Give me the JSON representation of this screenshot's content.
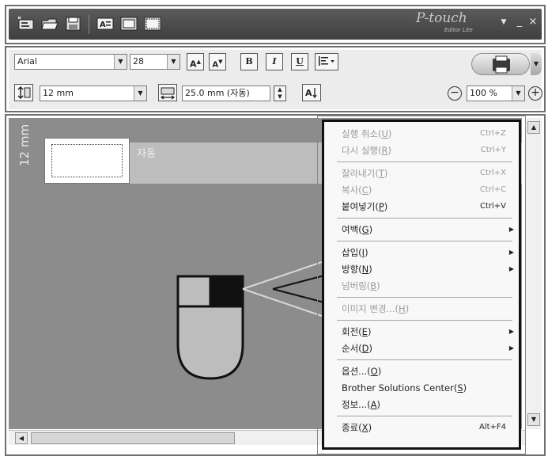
{
  "titlebar": {
    "logo": "P-touch",
    "logo_sub": "Editor Lite",
    "icons": [
      "new-label-icon",
      "open-folder-icon",
      "save-icon",
      "text-icon",
      "frame-icon",
      "image-icon"
    ],
    "minimize": "_",
    "close": "×"
  },
  "format_bar": {
    "font_name": "Arial",
    "font_size": "28",
    "grow_font": "A",
    "shrink_font": "A",
    "bold": "B",
    "italic": "I",
    "underline": "U",
    "tape_width": "12 mm",
    "label_length": "25.0 mm (자동)",
    "zoom": "100 %",
    "zoom_out": "−",
    "zoom_in": "+"
  },
  "canvas": {
    "auto_label": "자동",
    "tape_size": "12 mm"
  },
  "context_menu": {
    "groups": [
      [
        {
          "label": "실행 취소",
          "key": "U",
          "shortcut": "Ctrl+Z",
          "enabled": false,
          "submenu": false
        },
        {
          "label": "다시 실행",
          "key": "R",
          "shortcut": "Ctrl+Y",
          "enabled": false,
          "submenu": false
        }
      ],
      [
        {
          "label": "잘라내기",
          "key": "T",
          "shortcut": "Ctrl+X",
          "enabled": false,
          "submenu": false
        },
        {
          "label": "복사",
          "key": "C",
          "shortcut": "Ctrl+C",
          "enabled": false,
          "submenu": false
        },
        {
          "label": "붙여넣기",
          "key": "P",
          "shortcut": "Ctrl+V",
          "enabled": true,
          "submenu": false
        }
      ],
      [
        {
          "label": "여백",
          "key": "G",
          "shortcut": "",
          "enabled": true,
          "submenu": true
        }
      ],
      [
        {
          "label": "삽입",
          "key": "I",
          "shortcut": "",
          "enabled": true,
          "submenu": true
        },
        {
          "label": "방향",
          "key": "N",
          "shortcut": "",
          "enabled": true,
          "submenu": true
        },
        {
          "label": "넘버링",
          "key": "B",
          "shortcut": "",
          "enabled": false,
          "submenu": false
        }
      ],
      [
        {
          "label": "이미지 변경...",
          "key": "H",
          "shortcut": "",
          "enabled": false,
          "submenu": false
        }
      ],
      [
        {
          "label": "회전",
          "key": "E",
          "shortcut": "",
          "enabled": true,
          "submenu": true
        },
        {
          "label": "순서",
          "key": "D",
          "shortcut": "",
          "enabled": true,
          "submenu": true
        }
      ],
      [
        {
          "label": "옵션...",
          "key": "O",
          "shortcut": "",
          "enabled": true,
          "submenu": false
        },
        {
          "label": "Brother Solutions Center",
          "key": "S",
          "shortcut": "",
          "enabled": true,
          "submenu": false
        },
        {
          "label": "정보...",
          "key": "A",
          "shortcut": "",
          "enabled": true,
          "submenu": false
        }
      ],
      [
        {
          "label": "종료",
          "key": "X",
          "shortcut": "Alt+F4",
          "enabled": true,
          "submenu": false
        }
      ]
    ]
  }
}
